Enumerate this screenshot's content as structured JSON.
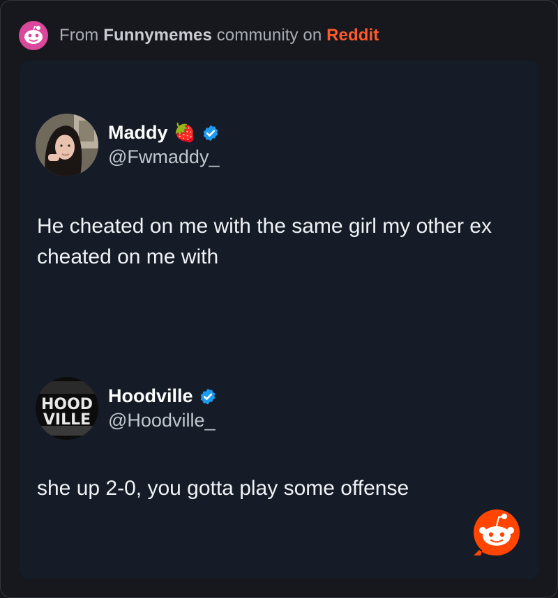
{
  "header": {
    "prefix": "From",
    "community": "Funnymemes",
    "middle": "community on",
    "platform": "Reddit"
  },
  "tweets": [
    {
      "name": "Maddy",
      "emoji": "🍓",
      "handle": "@Fwmaddy_",
      "verified": true,
      "text": "He cheated on me with the same girl my other ex cheated on me with"
    },
    {
      "name": "Hoodville",
      "handle": "@Hoodville_",
      "verified": true,
      "avatar_text_1": "HOOD",
      "avatar_text_2": "VILLE",
      "text": "she up 2-0, you gotta play some offense"
    }
  ],
  "colors": {
    "background": "#16181d",
    "card": "#151c27",
    "reddit_orange": "#ff5a2c",
    "verified_blue": "#1d9bf0"
  },
  "icons": {
    "community": "reddit-snoo-icon",
    "verified": "verified-badge-icon",
    "watermark": "reddit-logo-icon"
  }
}
